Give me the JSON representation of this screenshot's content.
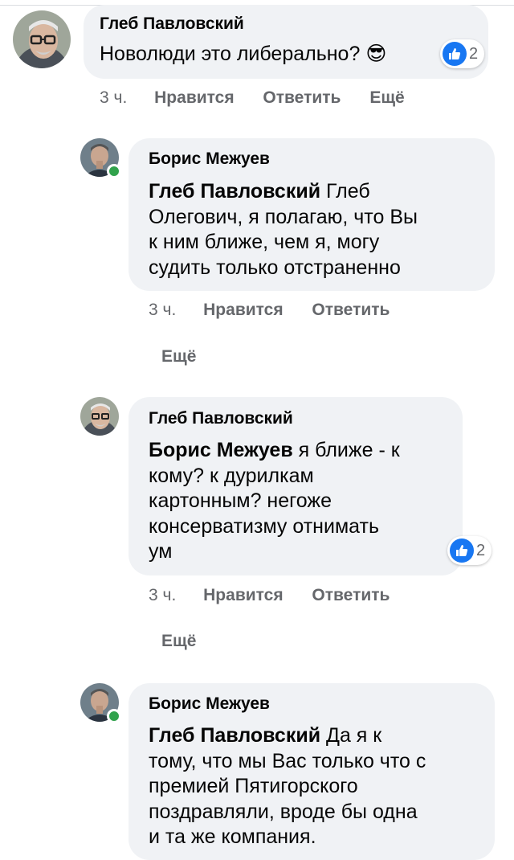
{
  "comments": [
    {
      "author": "Глеб Павловский",
      "text": "Новолюди это либерально?",
      "emoji": "😎",
      "reactions": "2",
      "time": "3 ч.",
      "like": "Нравится",
      "reply": "Ответить",
      "more": "Ещё"
    },
    {
      "author": "Борис Межуев",
      "mention": "Глеб Павловский",
      "text_lines": [
        "Глеб",
        "Олегович, я полагаю, что Вы",
        "к ним ближе, чем я, могу",
        "судить только отстраненно"
      ],
      "time": "3 ч.",
      "like": "Нравится",
      "reply": "Ответить",
      "more": "Ещё"
    },
    {
      "author": "Глеб Павловский",
      "mention": "Борис Межуев",
      "text_lines": [
        "я ближе - к",
        "кому? к дурилкам",
        "картонным? негоже",
        "консерватизму отнимать",
        "ум"
      ],
      "reactions": "2",
      "time": "3 ч.",
      "like": "Нравится",
      "reply": "Ответить",
      "more": "Ещё"
    },
    {
      "author": "Борис Межуев",
      "mention": "Глеб Павловский",
      "text_lines": [
        "Да я к",
        "тому, что мы Вас только что с",
        "премией Пятигорского",
        "поздравляли, вроде бы одна",
        "и та же компания."
      ]
    }
  ],
  "colors": {
    "bubble": "#f0f2f5",
    "meta": "#65676b",
    "like_blue": "#1877f2",
    "online": "#31a24c"
  }
}
